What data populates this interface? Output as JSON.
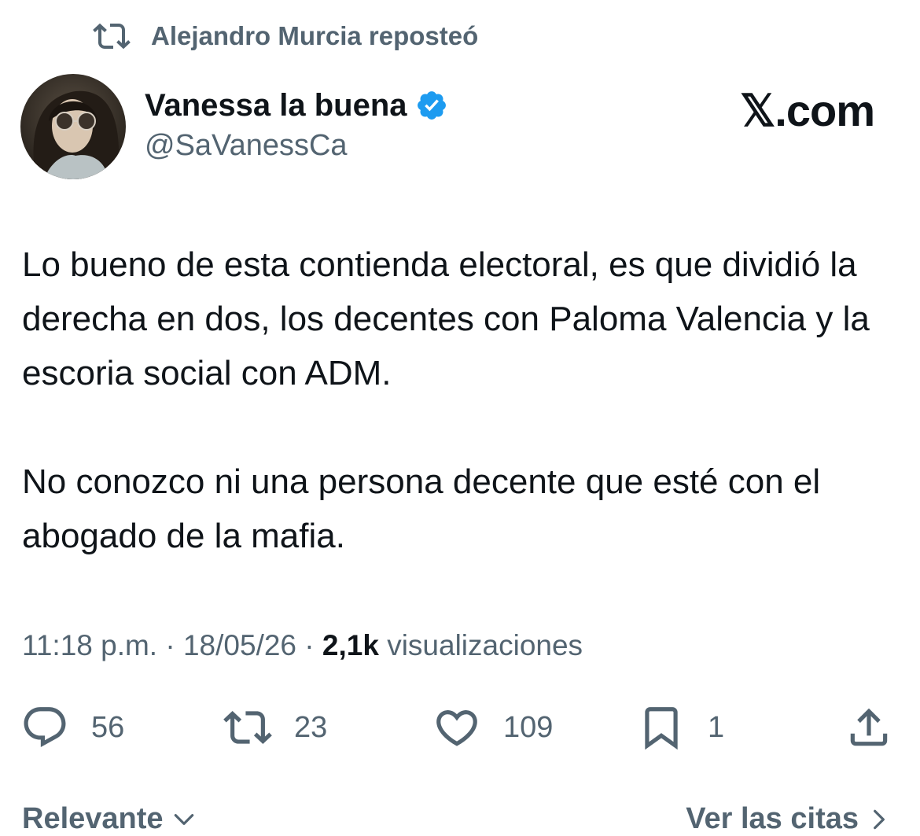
{
  "repost": {
    "icon": "repost-icon",
    "text": "Alejandro Murcia reposteó"
  },
  "author": {
    "display_name": "Vanessa la buena",
    "handle": "@SaVanessCa",
    "verified": true,
    "verified_color": "#1d9bf0"
  },
  "brand": "𝕏.com",
  "tweet": {
    "paragraphs": [
      "Lo bueno de esta contienda electoral, es que dividió la derecha en dos, los decentes con Paloma Valencia y la escoria social con ADM.",
      "No conozco ni una persona decente que esté con el abogado de la mafia."
    ]
  },
  "meta": {
    "time": "11:18 p.m.",
    "date": "18/05/26",
    "separator": "·",
    "views_count": "2,1k",
    "views_label": "visualizaciones"
  },
  "actions": {
    "replies": "56",
    "reposts": "23",
    "likes": "109",
    "bookmarks": "1"
  },
  "footer": {
    "sort_label": "Relevante",
    "quotes_label": "Ver las citas"
  },
  "colors": {
    "secondary_text": "#536471",
    "primary_text": "#0f1419",
    "accent": "#1d9bf0"
  }
}
